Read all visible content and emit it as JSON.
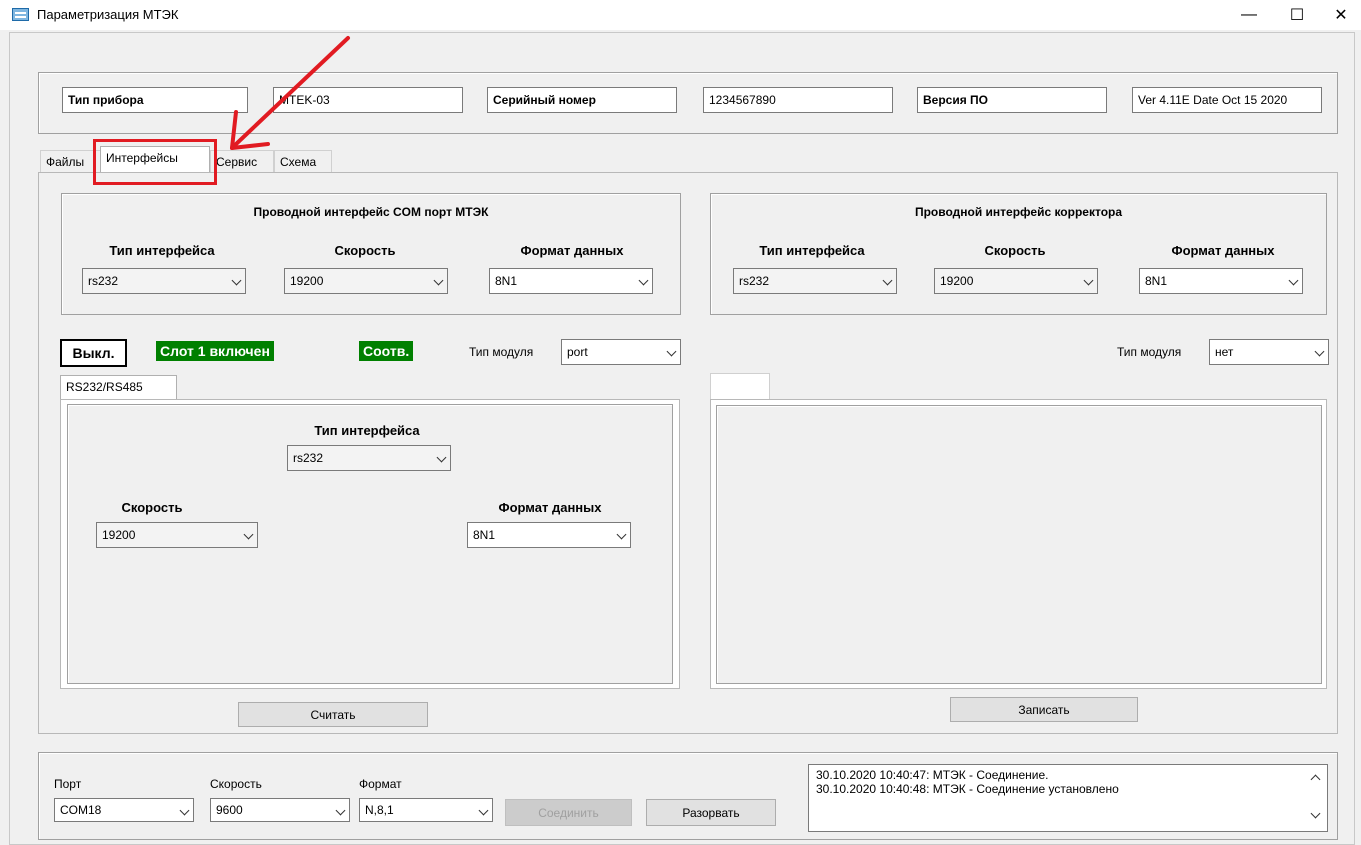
{
  "window": {
    "title": "Параметризация МТЭК",
    "minimize": "—",
    "maximize": "☐",
    "close": "✕"
  },
  "device_info": {
    "type_label": "Тип прибора",
    "type_value": "MTEK-03",
    "serial_label": "Серийный номер",
    "serial_value": "1234567890",
    "version_label": "Версия ПО",
    "version_value": "Ver 4.11E Date Oct 15 2020"
  },
  "tabs": [
    {
      "label": "Файлы"
    },
    {
      "label": "Интерфейсы"
    },
    {
      "label": "Сервис"
    },
    {
      "label": "Схема"
    }
  ],
  "com_group": {
    "title": "Проводной интерфейс COM порт МТЭК",
    "type_label": "Тип интерфейса",
    "type_value": "rs232",
    "speed_label": "Скорость",
    "speed_value": "19200",
    "format_label": "Формат данных",
    "format_value": "8N1"
  },
  "corrector_group": {
    "title": "Проводной интерфейс корректора",
    "type_label": "Тип интерфейса",
    "type_value": "rs232",
    "speed_label": "Скорость",
    "speed_value": "19200",
    "format_label": "Формат данных",
    "format_value": "8N1"
  },
  "slot1": {
    "off_button": "Выкл.",
    "status": "Слот 1 включен",
    "match": "Соотв.",
    "module_label": "Тип модуля",
    "module_value": "port",
    "subtab": "RS232/RS485",
    "type_label": "Тип интерфейса",
    "type_value": "rs232",
    "speed_label": "Скорость",
    "speed_value": "19200",
    "format_label": "Формат данных",
    "format_value": "8N1",
    "read_button": "Считать"
  },
  "slot2": {
    "module_label": "Тип модуля",
    "module_value": "нет",
    "write_button": "Записать"
  },
  "connection": {
    "port_label": "Порт",
    "port_value": "COM18",
    "speed_label": "Скорость",
    "speed_value": "9600",
    "format_label": "Формат",
    "format_value": "N,8,1",
    "connect_button": "Соединить",
    "disconnect_button": "Разорвать"
  },
  "log": [
    "30.10.2020 10:40:47:  МТЭК - Соединение.",
    "30.10.2020 10:40:48:  МТЭК - Соединение установлено"
  ],
  "colors": {
    "status_green": "#008000",
    "annotation_red": "#e11b22"
  }
}
